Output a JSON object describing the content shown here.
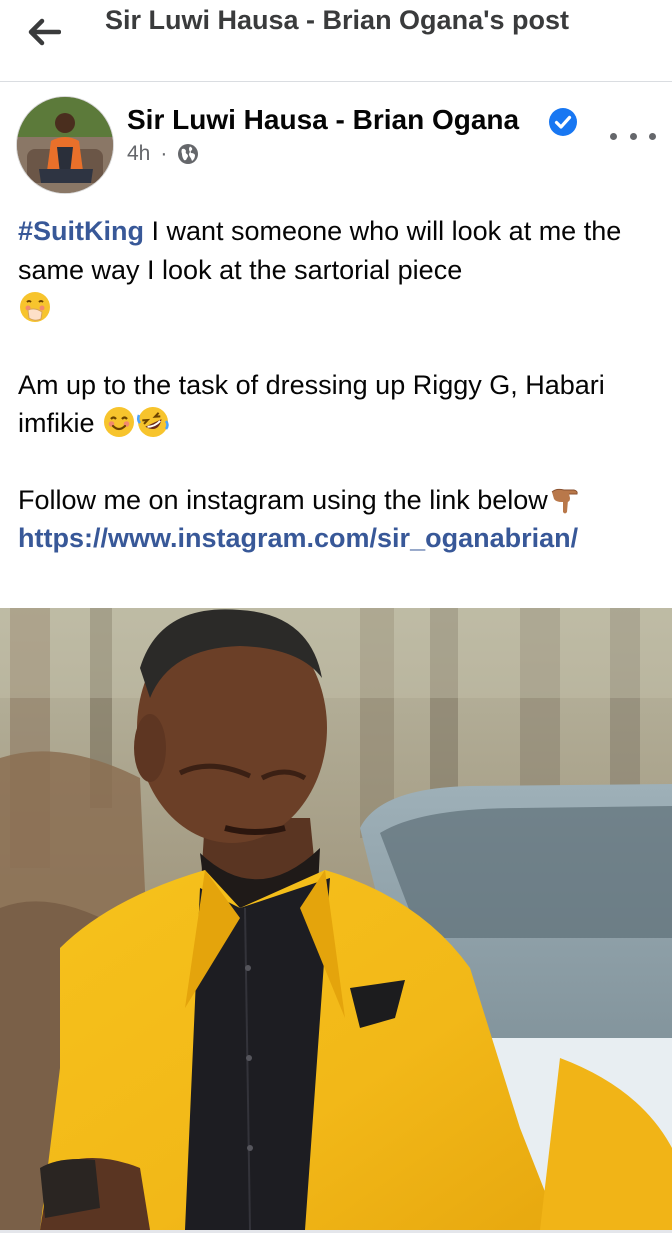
{
  "topbar": {
    "title": "Sir Luwi Hausa - Brian Ogana's post",
    "back_icon": "arrow-left-icon"
  },
  "post": {
    "author": "Sir Luwi Hausa - Brian Ogana",
    "verified": true,
    "time": "4h",
    "separator": "·",
    "audience_icon": "globe-icon",
    "hashtag": "#SuitKing",
    "text_line1": " I want someone who will look at me the same way I look at the sartorial piece",
    "text_line2": "Am up to the task of dressing up Riggy G, Habari imfikie",
    "text_line3": "Follow me on instagram using the link below",
    "link": "https://www.instagram.com/sir_oganabrian/",
    "emoji_icons": [
      "face-with-hand-over-mouth-emoji",
      "smiling-face-emoji",
      "rolling-on-floor-laughing-emoji",
      "backhand-index-pointing-down-emoji"
    ]
  },
  "colors": {
    "link": "#385898",
    "verified": "#1877f2",
    "secondary_text": "#65676b",
    "suit_yellow": "#f2b818"
  }
}
